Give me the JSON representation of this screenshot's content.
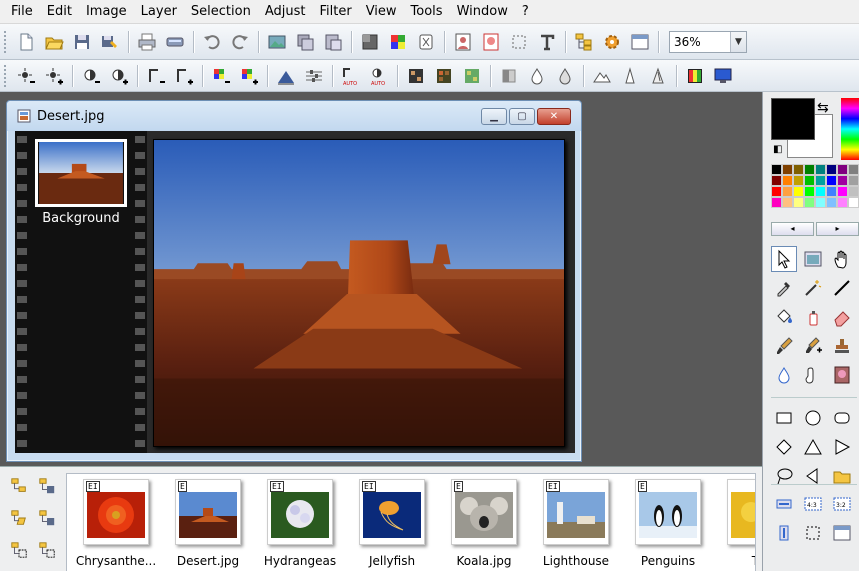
{
  "menu": [
    "File",
    "Edit",
    "Image",
    "Layer",
    "Selection",
    "Adjust",
    "Filter",
    "View",
    "Tools",
    "Window",
    "?"
  ],
  "toolbar": {
    "zoom_value": "36%"
  },
  "document": {
    "title": "Desert.jpg",
    "layer_name": "Background"
  },
  "browser": {
    "items": [
      {
        "name": "Chrysanthe...",
        "badge": "EI",
        "scene": "chrysanthemum"
      },
      {
        "name": "Desert.jpg",
        "badge": "E",
        "scene": "desert"
      },
      {
        "name": "Hydrangeas",
        "badge": "EI",
        "scene": "hydrangeas"
      },
      {
        "name": "Jellyfish",
        "badge": "EI",
        "scene": "jellyfish"
      },
      {
        "name": "Koala.jpg",
        "badge": "E",
        "scene": "koala"
      },
      {
        "name": "Lighthouse",
        "badge": "EI",
        "scene": "lighthouse"
      },
      {
        "name": "Penguins",
        "badge": "E",
        "scene": "penguins"
      },
      {
        "name": "Tul",
        "badge": "",
        "scene": "tulips"
      }
    ]
  },
  "colors": {
    "foreground": "#000000",
    "background": "#ffffff"
  }
}
